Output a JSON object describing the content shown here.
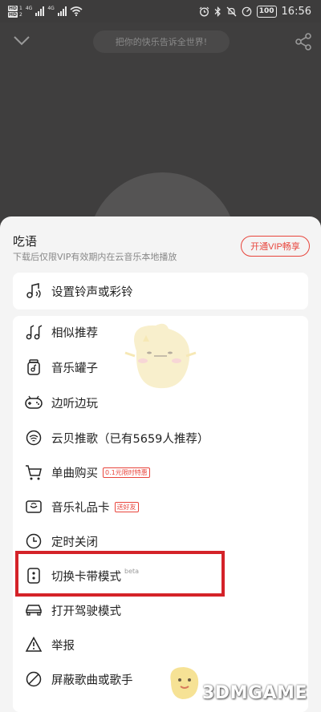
{
  "status_bar": {
    "sim1": "1",
    "sim2": "2",
    "hd": "HD",
    "net1": "4G",
    "net2": "4G",
    "battery": "100",
    "time": "16:56"
  },
  "player": {
    "hint_placeholder": "把你的快乐告诉全世界!"
  },
  "song": {
    "title": "吃语",
    "subtitle": "下载后仅限VIP有效期内在云音乐本地播放",
    "vip_button": "开通VIP畅享"
  },
  "menu": {
    "ringtone": "设置铃声或彩铃",
    "items": [
      {
        "label": "相似推荐",
        "icon": "similar-icon"
      },
      {
        "label": "音乐罐子",
        "icon": "music-jar-icon"
      },
      {
        "label": "边听边玩",
        "icon": "gamepad-icon"
      },
      {
        "label": "云贝推歌（已有5659人推荐）",
        "icon": "cloud-coin-icon"
      },
      {
        "label": "单曲购买",
        "icon": "cart-icon",
        "tag": "0.1元限时特惠"
      },
      {
        "label": "音乐礼品卡",
        "icon": "gift-card-icon",
        "tag": "送好友"
      },
      {
        "label": "定时关闭",
        "icon": "clock-icon"
      },
      {
        "label": "切换卡带模式",
        "icon": "cassette-icon",
        "badge": "beta"
      },
      {
        "label": "打开驾驶模式",
        "icon": "car-icon"
      },
      {
        "label": "举报",
        "icon": "warning-icon"
      },
      {
        "label": "屏蔽歌曲或歌手",
        "icon": "block-icon"
      }
    ]
  },
  "watermark": {
    "text": "3DMGAME"
  },
  "colors": {
    "accent": "#e8453c",
    "highlight": "#d42228",
    "sheet_bg": "#f4f4f4"
  }
}
